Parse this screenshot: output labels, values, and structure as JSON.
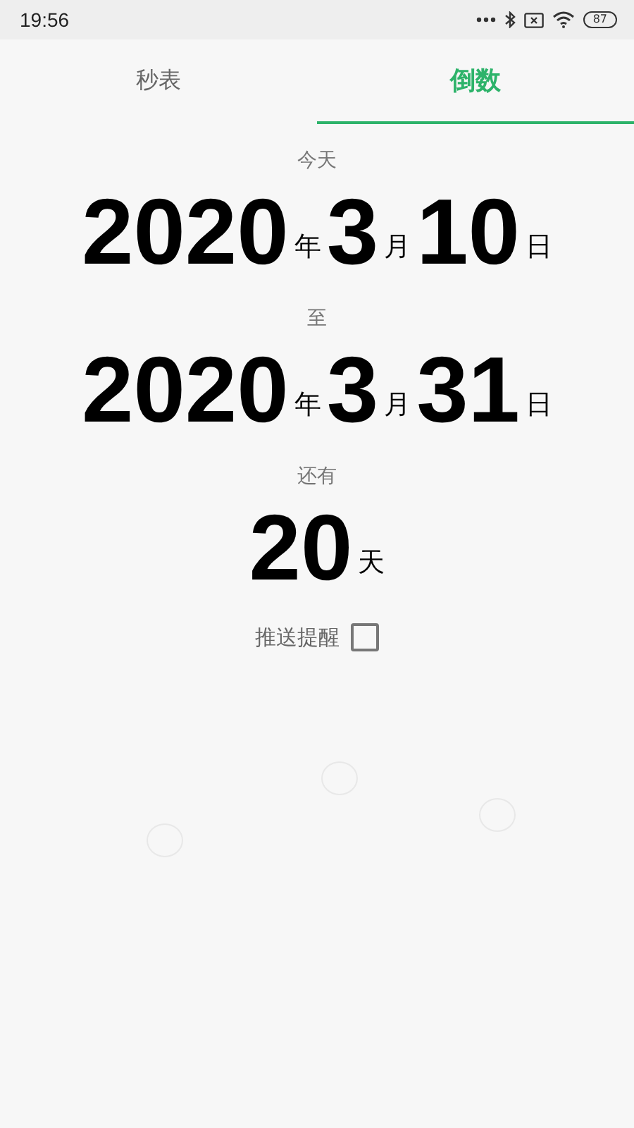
{
  "status_bar": {
    "time": "19:56",
    "battery": "87"
  },
  "tabs": [
    {
      "label": "秒表",
      "selected": false
    },
    {
      "label": "倒数",
      "selected": true
    }
  ],
  "today_label": "今天",
  "start_date": {
    "year": "2020",
    "year_unit": "年",
    "month": "3",
    "month_unit": "月",
    "day": "10",
    "day_unit": "日"
  },
  "to_label": "至",
  "end_date": {
    "year": "2020",
    "year_unit": "年",
    "month": "3",
    "month_unit": "月",
    "day": "31",
    "day_unit": "日"
  },
  "remaining_label": "还有",
  "remaining": {
    "value": "20",
    "unit": "天"
  },
  "push_reminder": {
    "label": "推送提醒",
    "checked": false
  }
}
